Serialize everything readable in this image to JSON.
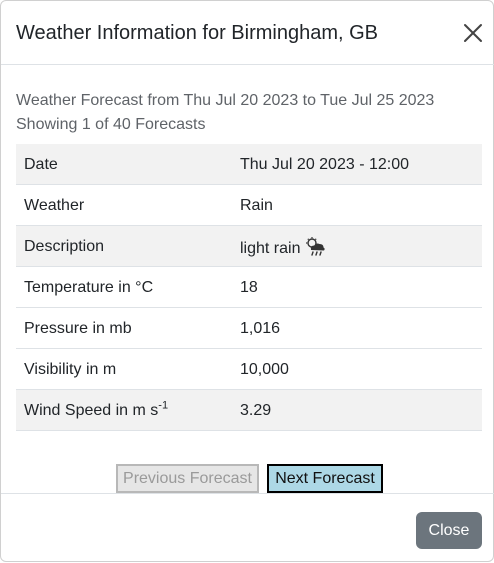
{
  "modal": {
    "title": "Weather Information for Birmingham, GB",
    "close_icon": "close-icon"
  },
  "summary": {
    "range": "Weather Forecast from Thu Jul 20 2023 to Tue Jul 25 2023",
    "count": "Showing 1 of 40 Forecasts"
  },
  "table": {
    "rows": [
      {
        "label": "Date",
        "value": "Thu Jul 20 2023 - 12:00"
      },
      {
        "label": "Weather",
        "value": "Rain"
      },
      {
        "label": "Description",
        "value": "light rain",
        "icon": "light-rain-icon"
      },
      {
        "label": "Temperature in °C",
        "value": "18"
      },
      {
        "label": "Pressure in mb",
        "value": "1,016"
      },
      {
        "label": "Visibility in m",
        "value": "10,000"
      },
      {
        "label": "Wind Speed in m s",
        "label_sup": "-1",
        "value": "3.29"
      }
    ]
  },
  "navigation": {
    "prev_label": "Previous Forecast",
    "next_label": "Next Forecast",
    "prev_disabled": true
  },
  "footer": {
    "close_label": "Close"
  },
  "colors": {
    "next_button_bg": "#add8e6",
    "close_button_bg": "#6c757d",
    "row_stripe": "#f2f2f2"
  }
}
